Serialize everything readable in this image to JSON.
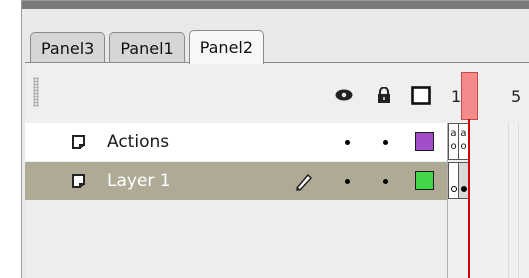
{
  "tabs": [
    {
      "label": "Panel3",
      "active": false
    },
    {
      "label": "Panel1",
      "active": false
    },
    {
      "label": "Panel2",
      "active": true
    }
  ],
  "header": {
    "icons": [
      "eye-icon",
      "lock-icon",
      "outline-square-icon"
    ],
    "frame_numbers": [
      "1",
      "5"
    ]
  },
  "layers": [
    {
      "name": "Actions",
      "outline_color": "#a14ec8",
      "selected": false,
      "editing": false,
      "icon": "layer-icon"
    },
    {
      "name": "Layer 1",
      "outline_color": "#43d64b",
      "selected": true,
      "editing": true,
      "icon": "layer-icon"
    }
  ],
  "timeline": {
    "actions_cells": [
      "a o",
      "a o"
    ],
    "layer1_keyframes": [
      "empty",
      "filled"
    ]
  },
  "colors": {
    "selected_row": "#aeaa95",
    "playhead": "#d40000",
    "playhead_box": "#f58a8a"
  }
}
